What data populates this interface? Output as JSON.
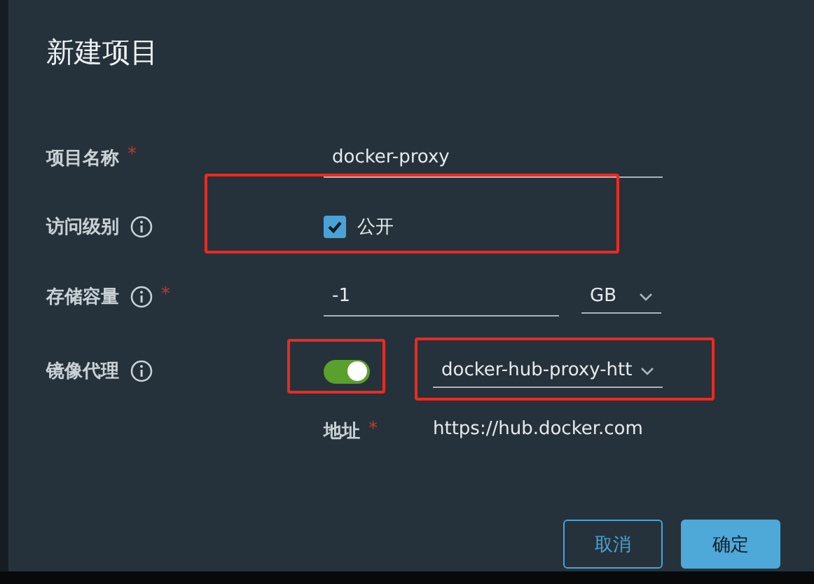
{
  "dialog": {
    "title": "新建项目"
  },
  "fields": [
    {
      "kind": "text",
      "label": "项目名称",
      "required_mark": "*",
      "info": false,
      "value": "docker-proxy"
    },
    {
      "kind": "checkbox",
      "label": "访问级别",
      "info": true,
      "option": "公开",
      "checked": true,
      "highlighted": true
    },
    {
      "kind": "quota",
      "label": "存储容量",
      "info": true,
      "required_mark": "*",
      "value": "-1",
      "unit": "GB"
    },
    {
      "kind": "proxy",
      "label": "镜像代理",
      "info": true,
      "on": true,
      "toggle_highlighted": true,
      "endpoint": "docker-hub-proxy-htt",
      "select_highlighted": true
    }
  ],
  "address": {
    "label": "地址",
    "required_mark": "*",
    "value": "https://hub.docker.com"
  },
  "buttons": [
    {
      "label": "取消",
      "kind": "secondary"
    },
    {
      "label": "确定",
      "kind": "primary"
    }
  ]
}
